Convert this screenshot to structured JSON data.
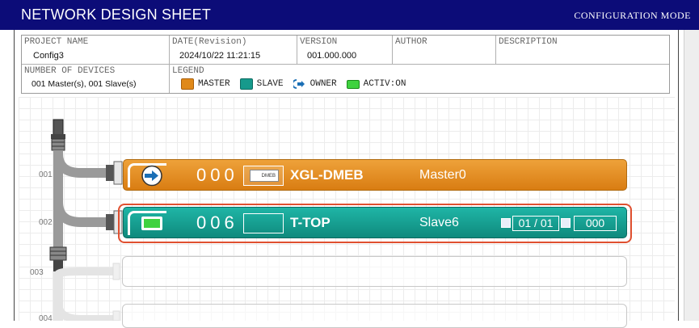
{
  "header": {
    "title": "NETWORK DESIGN SHEET",
    "mode": "CONFIGURATION MODE"
  },
  "info": {
    "project_name_label": "PROJECT NAME",
    "project_name": "Config3",
    "date_label": "DATE(Revision)",
    "date": "2024/10/22 11:21:15",
    "version_label": "VERSION",
    "version": "001.000.000",
    "author_label": "AUTHOR",
    "author": "",
    "description_label": "DESCRIPTION",
    "description": "",
    "devices_label": "NUMBER OF DEVICES",
    "devices": "001 Master(s), 001 Slave(s)",
    "legend_label": "LEGEND",
    "legend": {
      "master": "MASTER",
      "slave": "SLAVE",
      "owner": "OWNER",
      "activ": "ACTIV:ON"
    }
  },
  "rows": {
    "r1": "001",
    "r2": "002",
    "r3": "003",
    "r4": "004"
  },
  "devices": [
    {
      "station": "000",
      "module_icon_text": "DMEB",
      "name": "XGL-DMEB",
      "label": "Master0",
      "type": "master"
    },
    {
      "station": "006",
      "name": "T-TOP",
      "label": "Slave6",
      "type": "slave",
      "io": "01 / 01",
      "addr": "000"
    }
  ],
  "colors": {
    "title_bar": "#0c0c78",
    "master": "#e0891a",
    "slave": "#169a8c",
    "selection": "#e05030"
  }
}
